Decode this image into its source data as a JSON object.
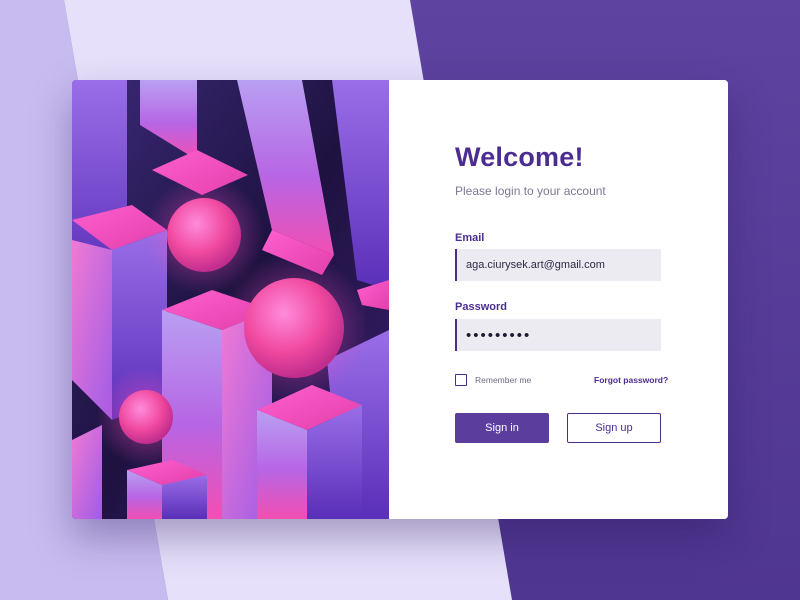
{
  "colors": {
    "accent": "#4b2d91",
    "button_primary": "#5a3d9c",
    "field_background": "#ecebf2",
    "page_background": "#5a3f9b",
    "illustration_pink": "#f14fb8",
    "illustration_violet": "#8a5fe0"
  },
  "login": {
    "title": "Welcome!",
    "subtitle": "Please login to your account",
    "email": {
      "label": "Email",
      "value": "aga.ciurysek.art@gmail.com"
    },
    "password": {
      "label": "Password",
      "masked_value": "•••••••••"
    },
    "remember_me": {
      "label": "Remember me",
      "checked": false
    },
    "forgot_password": "Forgot password?",
    "sign_in": "Sign in",
    "sign_up": "Sign up"
  }
}
